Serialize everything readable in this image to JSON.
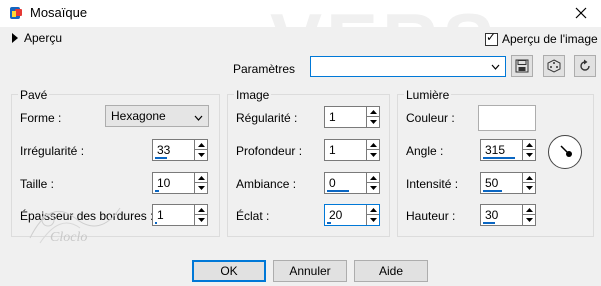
{
  "window": {
    "title": "Mosaïque"
  },
  "watermark": "VERS",
  "header": {
    "apercu_label": "Aperçu",
    "apercu_image_label": "Aperçu de l'image",
    "apercu_image_checked": true
  },
  "params": {
    "label": "Paramètres",
    "value": ""
  },
  "pave": {
    "title": "Pavé",
    "forme_label": "Forme :",
    "forme_value": "Hexagone",
    "irregularite_label": "Irrégularité :",
    "irregularite_value": "33",
    "irregularite_fraction": 0.33,
    "taille_label": "Taille :",
    "taille_value": "10",
    "taille_fraction": 0.1,
    "epaisseur_label": "Épaisseur des bordures :",
    "epaisseur_value": "1",
    "epaisseur_fraction": 0.05
  },
  "image": {
    "title": "Image",
    "regularite_label": "Régularité :",
    "regularite_value": "1",
    "profondeur_label": "Profondeur :",
    "profondeur_value": "1",
    "ambiance_label": "Ambiance :",
    "ambiance_value": "0",
    "ambiance_fraction": 0.6,
    "eclat_label": "Éclat :",
    "eclat_value": "20",
    "eclat_fraction": 0.1
  },
  "lumiere": {
    "title": "Lumière",
    "couleur_label": "Couleur :",
    "angle_label": "Angle :",
    "angle_value": "315",
    "angle_fraction": 0.875,
    "intensite_label": "Intensité :",
    "intensite_value": "50",
    "intensite_fraction": 0.5,
    "hauteur_label": "Hauteur :",
    "hauteur_value": "30",
    "hauteur_fraction": 0.33
  },
  "buttons": {
    "ok": "OK",
    "annuler": "Annuler",
    "aide": "Aide"
  },
  "decoration": {
    "text": "Cloclo"
  },
  "colors": {
    "accent": "#0a66c2",
    "primary_border": "#0078d7"
  },
  "icons": {
    "app": "paint-palette-icon",
    "close": "close-icon",
    "save": "save-icon",
    "random": "dice-icon",
    "reset": "reset-icon"
  }
}
